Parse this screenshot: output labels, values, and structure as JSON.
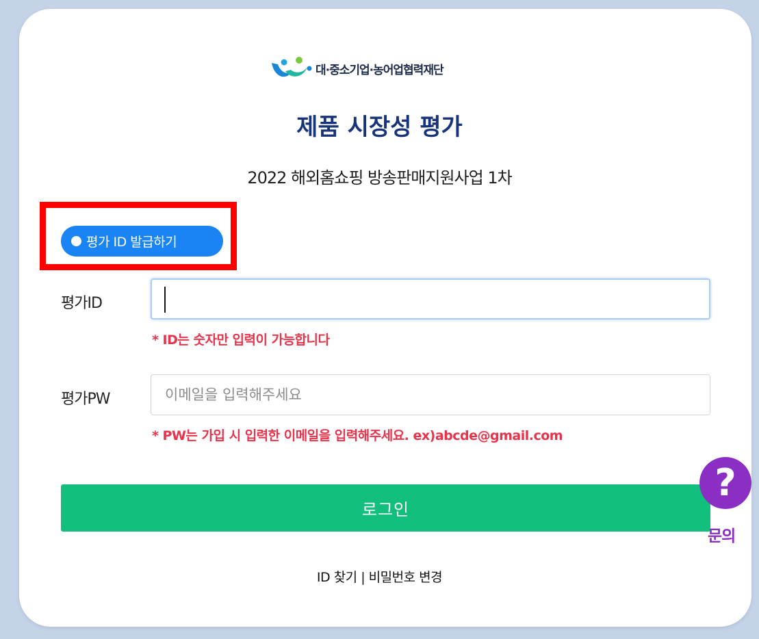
{
  "org": {
    "name": "대·중소기업·농어업협력재단",
    "logo_icon": "cooperation-foundation-logo-icon"
  },
  "page": {
    "title": "제품 시장성 평가",
    "subtitle": "2022 해외홈쇼핑 방송판매지원사업 1차"
  },
  "issue_button": {
    "label": "평가 ID 발급하기"
  },
  "form": {
    "id_label": "평가ID",
    "id_value": "",
    "id_hint": "* ID는 숫자만 입력이 가능합니다",
    "pw_label": "평가PW",
    "pw_placeholder": "이메일을 입력해주세요",
    "pw_hint": "* PW는 가입 시 입력한 이메일을 입력해주세요. ex)abcde@gmail.com",
    "login_label": "로그인"
  },
  "links": {
    "find_id": "ID 찾기",
    "separator": "|",
    "change_pw": "비밀번호 변경"
  },
  "help": {
    "icon": "question-mark-icon",
    "glyph": "?",
    "label": "문의"
  },
  "colors": {
    "background": "#c5d3e8",
    "title": "#17337a",
    "issue_button": "#1a84f5",
    "login_button": "#13bf7d",
    "hint": "#e8334a",
    "help": "#8b2fc4",
    "highlight": "#ff0000"
  }
}
